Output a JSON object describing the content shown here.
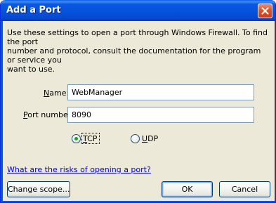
{
  "window": {
    "title": "Add a Port",
    "close_icon": "close-icon"
  },
  "description": "Use these settings to open a port through Windows Firewall. To find the port\nnumber and protocol, consult the documentation for the program or service you\nwant to use.",
  "form": {
    "name": {
      "label_mnemonic": "N",
      "label_rest": "ame:",
      "value": "WebManager"
    },
    "port": {
      "label_mnemonic": "P",
      "label_rest": "ort number:",
      "value": "8090"
    },
    "protocols": [
      {
        "mnemonic": "T",
        "rest": "CP",
        "selected": true
      },
      {
        "mnemonic": "U",
        "rest": "DP",
        "selected": false
      }
    ]
  },
  "risk_link": "What are the risks of opening a port?",
  "buttons": {
    "change_scope": "Change scope...",
    "ok": "OK",
    "cancel": "Cancel"
  },
  "colors": {
    "titlebar": "#0553da",
    "dialog_bg": "#ece9d8",
    "close_red": "#d8552f",
    "radio_selected": "#21a121",
    "link": "#0000ff"
  }
}
